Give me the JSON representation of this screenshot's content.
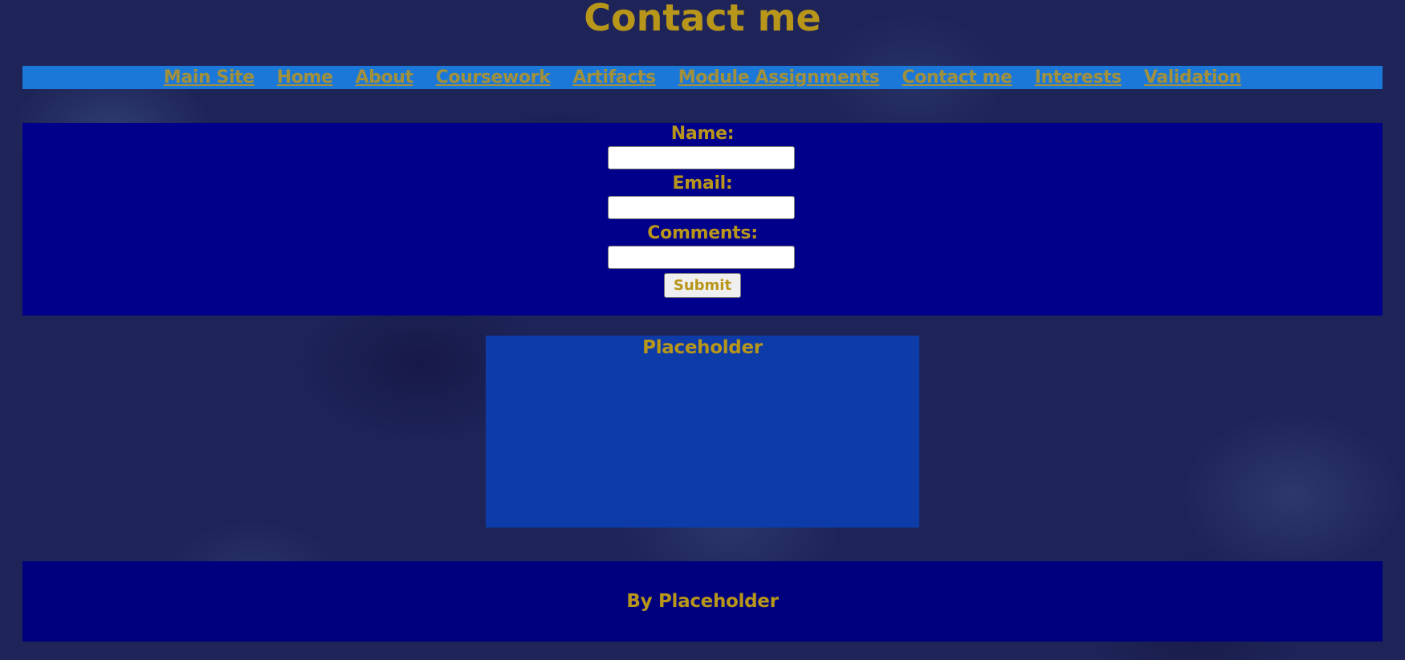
{
  "page": {
    "title": "Contact me"
  },
  "nav": {
    "items": [
      {
        "label": "Main Site"
      },
      {
        "label": "Home"
      },
      {
        "label": "About"
      },
      {
        "label": "Coursework"
      },
      {
        "label": "Artifacts"
      },
      {
        "label": "Module Assignments"
      },
      {
        "label": "Contact me"
      },
      {
        "label": "Interests"
      },
      {
        "label": "Validation"
      }
    ]
  },
  "form": {
    "name_label": "Name:",
    "name_value": "",
    "email_label": "Email:",
    "email_value": "",
    "comments_label": "Comments:",
    "comments_value": "",
    "submit_label": "Submit"
  },
  "placeholder": {
    "title": "Placeholder"
  },
  "footer": {
    "text": "By Placeholder"
  },
  "colors": {
    "accent_text": "#b8961a",
    "nav_link": "#a1903c",
    "nav_bar": "#1c78d8",
    "form_panel": "#00008b",
    "placeholder_box": "#0d3ca8",
    "footer": "#00007c",
    "background": "#1e2458"
  }
}
